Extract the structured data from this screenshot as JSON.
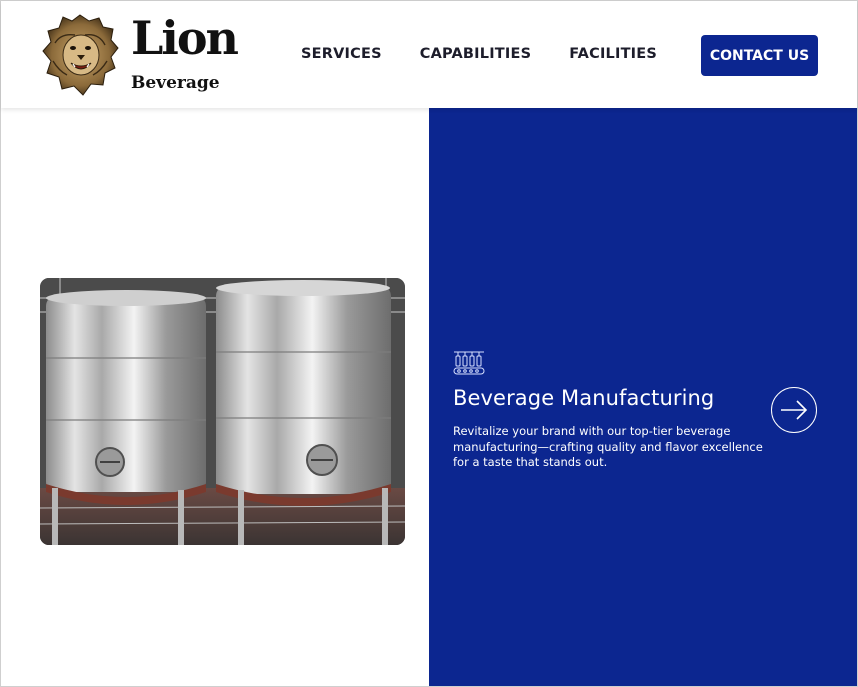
{
  "brand": {
    "name": "Lion",
    "sub": "Beverage"
  },
  "nav": {
    "items": [
      {
        "label": "SERVICES"
      },
      {
        "label": "CAPABILITIES"
      },
      {
        "label": "FACILITIES"
      }
    ],
    "cta_label": "CONTACT US"
  },
  "feature": {
    "icon": "bottle-conveyor-icon",
    "title": "Beverage Manufacturing",
    "description": "Revitalize your brand with our top-tier beverage manufacturing—crafting quality and flavor excellence for a taste that stands out.",
    "image": "stainless-steel-tanks-photo",
    "arrow_icon": "arrow-right-icon"
  },
  "colors": {
    "accent": "#0c2690",
    "text_dark": "#1d1d2b",
    "background": "#ffffff"
  }
}
